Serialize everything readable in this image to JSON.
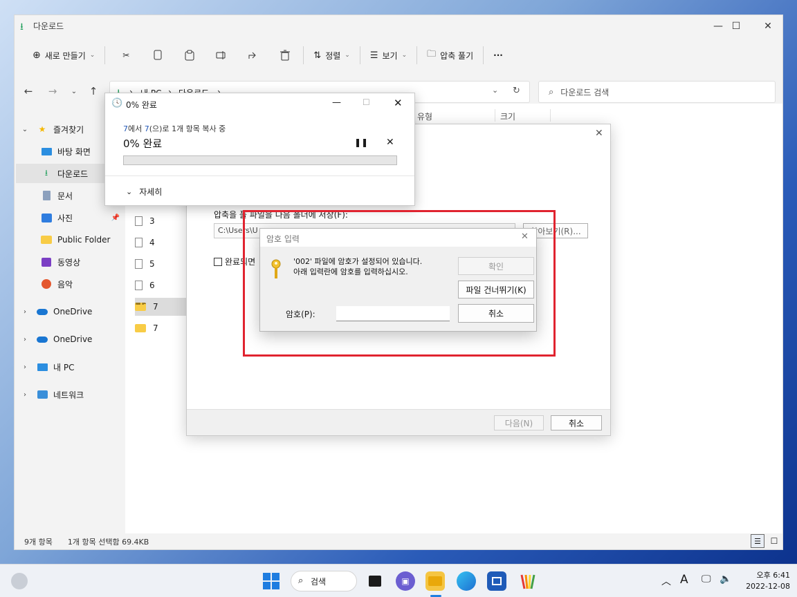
{
  "explorer": {
    "title": "다운로드",
    "toolbar": {
      "new_label": "새로 만들기",
      "sort_label": "정렬",
      "view_label": "보기",
      "extract_label": "압축 풀기",
      "more_label": "···"
    },
    "address": {
      "crumb_pc": "내 PC",
      "crumb_downloads": "다운로드",
      "sep": "›"
    },
    "search_placeholder": "다운로드 검색",
    "columns": {
      "type": "유형",
      "size": "크기"
    },
    "sidebar": {
      "favorites": "즐겨찾기",
      "desktop": "바탕 화면",
      "downloads": "다운로드",
      "documents": "문서",
      "pictures": "사진",
      "public_folder": "Public Folder",
      "videos": "동영상",
      "music": "음악",
      "onedrive1": "OneDrive",
      "onedrive2": "OneDrive",
      "this_pc": "내 PC",
      "network": "네트워크"
    },
    "files": [
      "3",
      "4",
      "5",
      "6",
      "7",
      "7"
    ],
    "status": {
      "count": "9개 항목",
      "selected": "1개 항목 선택함 69.4KB"
    }
  },
  "copy_dialog": {
    "title": "0% 완료",
    "line_prefix": "7",
    "line_mid": "에서 ",
    "line_dest": "7",
    "line_suffix": "(으)로 1개 항목 복사 중",
    "percent_text": "0% 완료",
    "progress": 0,
    "details_label": "자세히"
  },
  "wizard": {
    "extract_to_label": "압축을 풀 파일을 다음 폴더에 저장(F):",
    "path_value": "C:\\Users\\U",
    "browse_label": "찾아보기(R)...",
    "show_when_done_label": "완료되면",
    "next_label": "다음(N)",
    "cancel_label": "취소"
  },
  "password_dialog": {
    "title": "암호 입력",
    "message_line1": "'002' 파일에 암호가 설정되어 있습니다.",
    "message_line2": "아래 입력란에 암호를 입력하십시오.",
    "ok_label": "확인",
    "skip_label": "파일 건너뛰기(K)",
    "cancel_label": "취소",
    "password_label": "암호(P):",
    "password_value": ""
  },
  "taskbar": {
    "search_label": "검색",
    "ime_label": "A",
    "time": "오후 6:41",
    "date": "2022-12-08"
  },
  "colors": {
    "accent_green": "#06b025",
    "highlight_red": "#e0232f",
    "link_blue": "#2157b6"
  }
}
